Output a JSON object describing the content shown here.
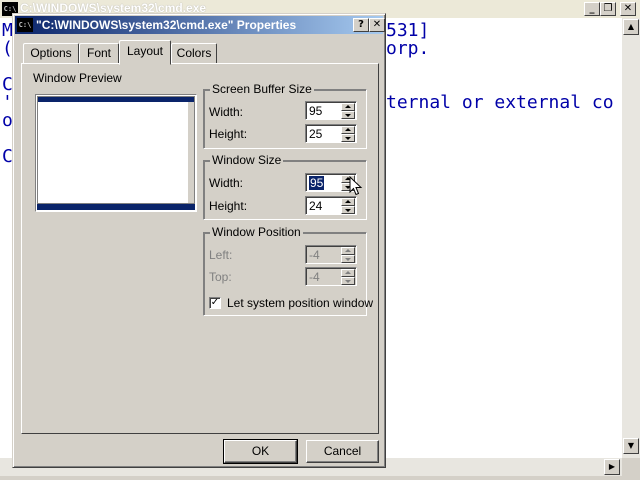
{
  "console": {
    "title": "C:\\WINDOWS\\system32\\cmd.exe",
    "icon": "C:\\",
    "minimize": "_",
    "maximize": "❐",
    "close": "✕",
    "visible_lines": [
      "M",
      "(",
      "C",
      "'",
      "o",
      "C"
    ],
    "right_fragments": [
      "531]",
      "orp.",
      "ternal or external co"
    ]
  },
  "dialog": {
    "title": "\"C:\\WINDOWS\\system32\\cmd.exe\" Properties",
    "icon": "C:\\",
    "help_button": "?",
    "close_button": "✕",
    "tabs": [
      {
        "label": "Options"
      },
      {
        "label": "Font"
      },
      {
        "label": "Layout"
      },
      {
        "label": "Colors"
      }
    ],
    "window_preview_label": "Window Preview",
    "screen_buffer": {
      "title": "Screen Buffer Size",
      "width_label": "Width:",
      "width": "95",
      "height_label": "Height:",
      "height": "25"
    },
    "window_size": {
      "title": "Window Size",
      "width_label": "Width:",
      "width": "95",
      "height_label": "Height:",
      "height": "24"
    },
    "window_position": {
      "title": "Window Position",
      "left_label": "Left:",
      "left": "-4",
      "top_label": "Top:",
      "top": "-4",
      "checkbox_label": "Let system position window",
      "checkbox_mark": "✓"
    },
    "ok_label": "OK",
    "cancel_label": "Cancel"
  }
}
